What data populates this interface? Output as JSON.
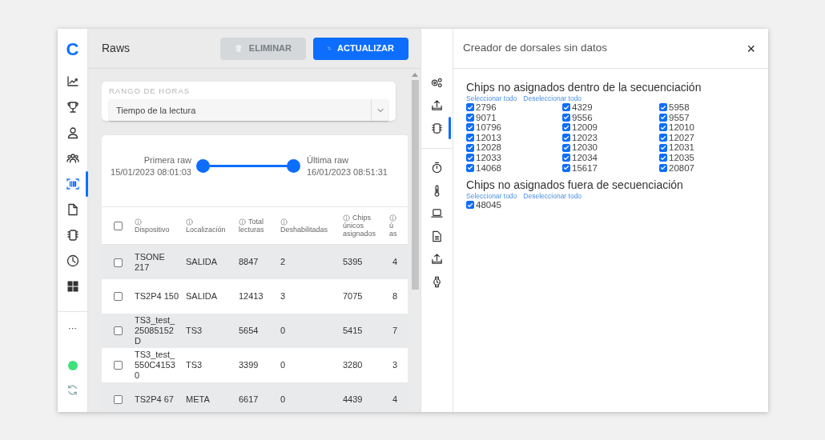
{
  "sidebar": {
    "logo": "C",
    "items": [
      {
        "kind": "chart",
        "selected": false
      },
      {
        "kind": "trophy",
        "selected": false
      },
      {
        "kind": "person",
        "selected": false
      },
      {
        "kind": "group",
        "selected": false
      },
      {
        "kind": "barcode",
        "selected": true
      },
      {
        "kind": "file",
        "selected": false
      },
      {
        "kind": "chip",
        "selected": false
      },
      {
        "kind": "clock",
        "selected": false
      },
      {
        "kind": "grid",
        "selected": false
      }
    ],
    "more": "···",
    "footer": [
      {
        "kind": "status"
      },
      {
        "kind": "refresh"
      }
    ]
  },
  "main": {
    "title": "Raws",
    "buttons": [
      {
        "kind": "delete",
        "label": "ELIMINAR",
        "disabled": true
      },
      {
        "kind": "refresh",
        "label": "ACTUALIZAR",
        "disabled": false
      }
    ],
    "filter": {
      "label": "RANGO DE HORAS",
      "value": "Tiempo de la lectura"
    },
    "range": {
      "start_label": "Primera raw",
      "start": "15/01/2023 08:01:03",
      "end_label": "Última raw",
      "end": "16/01/2023 08:51:31",
      "handles": [
        {
          "level": 0
        },
        {
          "level": 1
        }
      ]
    },
    "table": {
      "header_checked": false,
      "columns": [
        {
          "lines": [
            "Dispositivo"
          ]
        },
        {
          "lines": [
            "Localización"
          ]
        },
        {
          "lines": [
            "Total",
            "lecturas"
          ]
        },
        {
          "lines": [
            "Deshabilitadas"
          ]
        },
        {
          "lines": [
            "Chips",
            "únicos",
            "asignados"
          ]
        },
        {
          "lines": [
            "ú",
            "as"
          ]
        }
      ],
      "rows": [
        {
          "checked": false,
          "cells": [
            "TSONE 217",
            "SALIDA",
            "8847",
            "2",
            "5395",
            "4"
          ]
        },
        {
          "checked": false,
          "cells": [
            "TS2P4 150",
            "SALIDA",
            "12413",
            "3",
            "7075",
            "8"
          ]
        },
        {
          "checked": false,
          "cells": [
            "TS3_test_25085152D",
            "TS3",
            "5654",
            "0",
            "5415",
            "7"
          ]
        },
        {
          "checked": false,
          "cells": [
            "TS3_test_550C41530",
            "TS3",
            "3399",
            "0",
            "3280",
            "3"
          ]
        },
        {
          "checked": false,
          "cells": [
            "TS2P4 67",
            "META",
            "6617",
            "0",
            "4439",
            "4"
          ]
        }
      ]
    }
  },
  "toolbar": [
    [
      {
        "kind": "gears",
        "selected": false
      },
      {
        "kind": "upload",
        "selected": false
      },
      {
        "kind": "chip",
        "selected": true
      }
    ],
    [
      {
        "kind": "timer",
        "selected": false
      },
      {
        "kind": "thermometer",
        "selected": false
      },
      {
        "kind": "laptop",
        "selected": false
      },
      {
        "kind": "document",
        "selected": false
      },
      {
        "kind": "upload",
        "selected": false
      },
      {
        "kind": "watch",
        "selected": false
      }
    ]
  ],
  "panel": {
    "title": "Creador de dorsales sin datos",
    "close": "×",
    "sections": [
      {
        "title": "Chips no asignados dentro de la secuenciación",
        "select_all": "Seleccionar todo",
        "deselect_all": "Deseleccionar todo",
        "chips": [
          {
            "label": "2796",
            "checked": true
          },
          {
            "label": "4329",
            "checked": true
          },
          {
            "label": "5958",
            "checked": true
          },
          {
            "label": "9071",
            "checked": true
          },
          {
            "label": "9556",
            "checked": true
          },
          {
            "label": "9557",
            "checked": true
          },
          {
            "label": "10796",
            "checked": true
          },
          {
            "label": "12009",
            "checked": true
          },
          {
            "label": "12010",
            "checked": true
          },
          {
            "label": "12013",
            "checked": true
          },
          {
            "label": "12023",
            "checked": true
          },
          {
            "label": "12027",
            "checked": true
          },
          {
            "label": "12028",
            "checked": true
          },
          {
            "label": "12030",
            "checked": true
          },
          {
            "label": "12031",
            "checked": true
          },
          {
            "label": "12033",
            "checked": true
          },
          {
            "label": "12034",
            "checked": true
          },
          {
            "label": "12035",
            "checked": true
          },
          {
            "label": "14068",
            "checked": true
          },
          {
            "label": "15617",
            "checked": true
          },
          {
            "label": "20807",
            "checked": true
          }
        ]
      },
      {
        "title": "Chips no asignados fuera de secuenciación",
        "select_all": "Seleccionar todo",
        "deselect_all": "Deseleccionar todo",
        "chips": [
          {
            "label": "48045",
            "checked": true
          }
        ]
      }
    ]
  }
}
